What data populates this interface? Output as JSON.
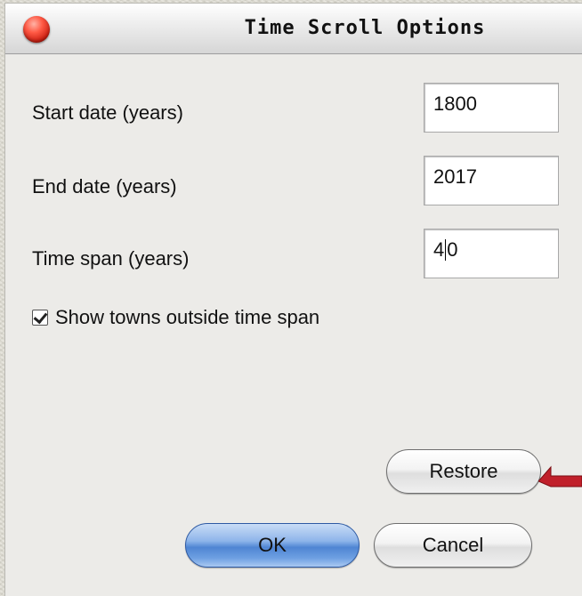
{
  "window": {
    "title": "Time Scroll Options"
  },
  "fields": [
    {
      "label": "Start date (years)",
      "value": "1800"
    },
    {
      "label": "End date (years)",
      "value": "2017"
    },
    {
      "label": "Time span (years)",
      "value_before_caret": "4",
      "value_after_caret": "0"
    }
  ],
  "checkbox": {
    "label": "Show towns outside time span",
    "checked": true
  },
  "buttons": {
    "restore": "Restore",
    "ok": "OK",
    "cancel": "Cancel"
  },
  "colors": {
    "arrow": "#c0202a",
    "default_button": "#4f85d3",
    "close_button": "#d9251a"
  }
}
